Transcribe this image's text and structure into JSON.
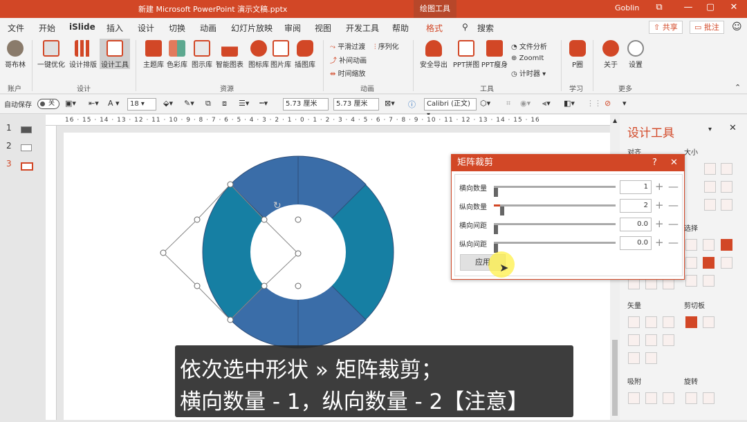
{
  "titlebar": {
    "title": "新建 Microsoft PowerPoint 演示文稿.pptx",
    "context": "绘图工具",
    "user": "Goblin",
    "minimize": "—",
    "restore": "▢",
    "close": "✕"
  },
  "menu": {
    "tabs": [
      "文件",
      "开始",
      "iSlide",
      "插入",
      "设计",
      "切换",
      "动画",
      "幻灯片放映",
      "审阅",
      "视图",
      "开发工具",
      "帮助",
      "格式"
    ],
    "search": "搜索",
    "share": "共享",
    "comment": "批注"
  },
  "ribbon": {
    "account": {
      "label": "哥布林",
      "group": "账户"
    },
    "design": {
      "items": [
        "一键优化",
        "设计排版",
        "设计工具"
      ],
      "group": "设计"
    },
    "resources": {
      "items": [
        "主题库",
        "色彩库",
        "图示库",
        "智能图表",
        "图标库",
        "图片库",
        "插图库"
      ],
      "group": "资源"
    },
    "animation": {
      "items": [
        "平滑过渡",
        "序列化",
        "补间动画",
        "时间缩放"
      ],
      "group": "动画"
    },
    "tools": {
      "items": [
        "安全导出",
        "PPT拼图",
        "PPT瘦身"
      ],
      "small": [
        "文件分析",
        "ZoomIt",
        "计时器"
      ],
      "group": "工具"
    },
    "learn": {
      "items": [
        "P圈"
      ],
      "group": "学习"
    },
    "more": {
      "items": [
        "关于",
        "设置"
      ],
      "group": "更多"
    }
  },
  "toolbar": {
    "autosave": "自动保存",
    "autosave_state": "关",
    "font_size": "18",
    "width": "5.73 厘米",
    "height": "5.73 厘米",
    "font": "Calibri (正文)"
  },
  "slides": {
    "numbers": [
      "1",
      "2",
      "3"
    ],
    "current": 3
  },
  "ruler": {
    "text": "16 · 15 · 14 · 13 · 12 · 11 · 10 · 9 · 8 · 7 · 6 · 5 · 4 · 3 · 2 · 1 · 0 · 1 · 2 · 3 · 4 · 5 · 6 · 7 · 8 · 9 · 10 · 11 · 12 · 13 · 14 · 15 · 16"
  },
  "dialog": {
    "title": "矩阵裁剪",
    "help": "?",
    "close": "✕",
    "rows": [
      {
        "label": "横向数量",
        "value": "1",
        "level": 0
      },
      {
        "label": "纵向数量",
        "value": "2",
        "level": 0.05
      },
      {
        "label": "横向间距",
        "value": "0.0",
        "level": 0
      },
      {
        "label": "纵向间距",
        "value": "0.0",
        "level": 0
      }
    ],
    "apply": "应用"
  },
  "panel": {
    "title": "设计工具",
    "sections": [
      "对齐",
      "大小",
      "选择",
      "矢量",
      "剪切板",
      "吸附",
      "旋转"
    ]
  },
  "caption": {
    "line1": "依次选中形状 » 矩阵裁剪；",
    "line2": "横向数量 - 1，纵向数量 - 2【注意】"
  },
  "colors": {
    "accent": "#d24726",
    "ring_dark": "#3a6da8",
    "ring_light": "#167fa3"
  }
}
